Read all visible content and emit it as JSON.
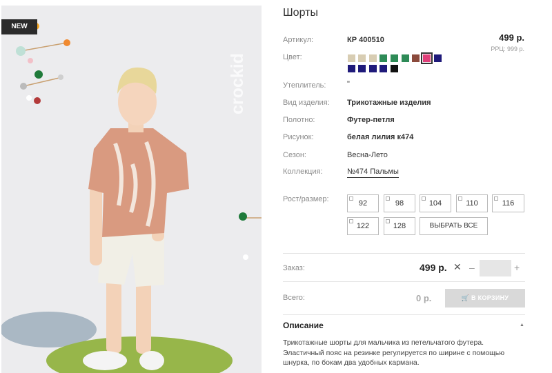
{
  "product": {
    "badge": "NEW",
    "brand": "crockid",
    "title": "Шорты",
    "price": "499 р.",
    "rrp": "РРЦ: 999 р."
  },
  "attributes": {
    "article_label": "Артикул:",
    "article_value": "КР 400510",
    "color_label": "Цвет:",
    "insulation_label": "Утеплитель:",
    "insulation_value": "\"",
    "type_label": "Вид изделия:",
    "type_value": "Трикотажные изделия",
    "fabric_label": "Полотно:",
    "fabric_value": "Футер-петля",
    "pattern_label": "Рисунок:",
    "pattern_value": "белая лилия к474",
    "season_label": "Сезон:",
    "season_value": "Весна-Лето",
    "collection_label": "Коллекция:",
    "collection_value": "№474 Пальмы"
  },
  "colors": [
    "#d8cdb3",
    "#d8cdb3",
    "#d8cdb3",
    "#2e8b57",
    "#2e8b57",
    "#2e8b57",
    "#8b4a3c",
    "#e0407a",
    "#1f1a7a",
    "#1f1a7a",
    "#1f1a7a",
    "#1f1a7a",
    "#1f1a7a",
    "#111111"
  ],
  "sizes": {
    "label": "Рост/размер:",
    "items": [
      "92",
      "98",
      "104",
      "110",
      "116",
      "122",
      "128"
    ],
    "select_all": "ВЫБРАТЬ ВСЕ"
  },
  "order": {
    "label": "Заказ:",
    "price": "499 р.",
    "clear": "✕",
    "minus": "–",
    "plus": "+",
    "quantity": ""
  },
  "total": {
    "label": "Всего:",
    "value": "0 р.",
    "cart_button": "В КОРЗИНУ"
  },
  "description": {
    "title": "Описание",
    "text": "Трикотажные шорты для мальчика из петельчатого футера. Эластичный пояс на резинке регулируется по ширине с помощью шнурка, по бокам два удобных кармана."
  }
}
